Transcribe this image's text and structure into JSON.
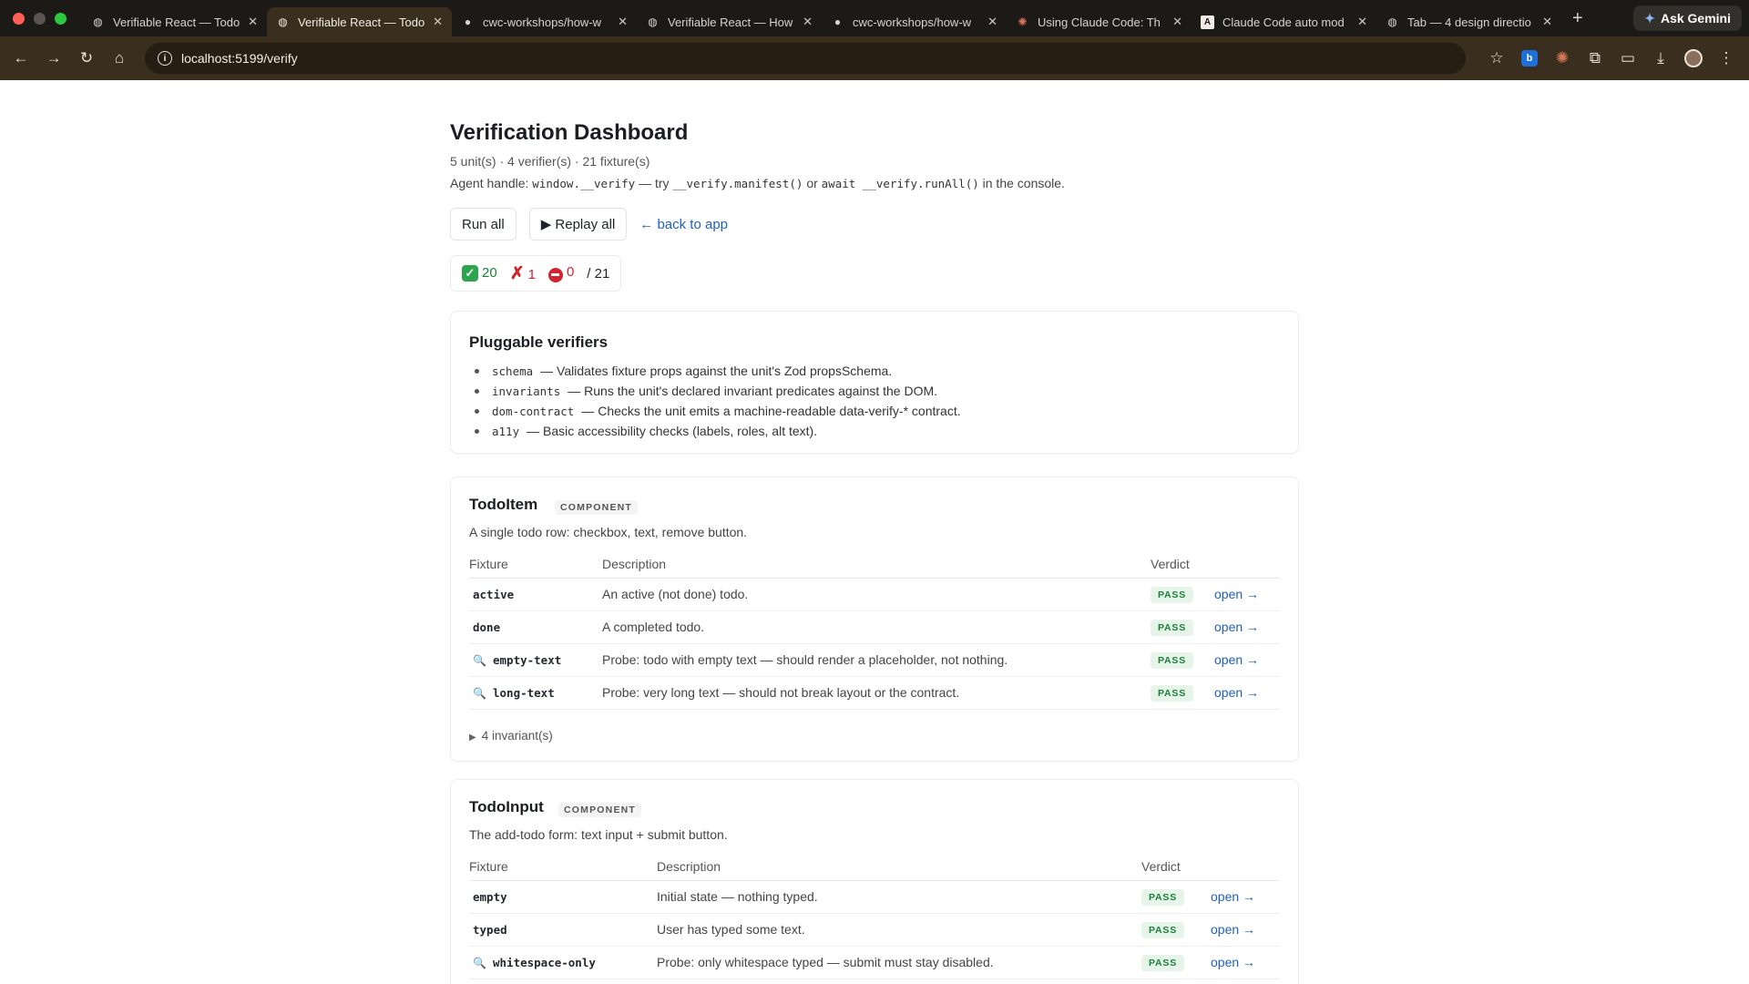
{
  "browser": {
    "tabs": [
      {
        "title": "Verifiable React — Todo",
        "icon": "globe-icon",
        "active": false
      },
      {
        "title": "Verifiable React — Todo",
        "icon": "globe-icon",
        "active": true
      },
      {
        "title": "cwc-workshops/how-w",
        "icon": "github-icon",
        "active": false
      },
      {
        "title": "Verifiable React — How",
        "icon": "globe-icon",
        "active": false
      },
      {
        "title": "cwc-workshops/how-w",
        "icon": "github-icon",
        "active": false
      },
      {
        "title": "Using Claude Code: Th",
        "icon": "claude-icon",
        "active": false
      },
      {
        "title": "Claude Code auto mod",
        "icon": "anthropic-icon",
        "active": false
      },
      {
        "title": "Tab — 4 design directio",
        "icon": "globe-icon",
        "active": false
      }
    ],
    "gemini_label": "Ask Gemini",
    "url": "localhost:5199/verify"
  },
  "page": {
    "title": "Verification Dashboard",
    "counts": "5 unit(s) · 4 verifier(s) · 21 fixture(s)",
    "handle": {
      "prefix": "Agent handle:",
      "code1": "window.__verify",
      "mid1": "— try",
      "code2": "__verify.manifest()",
      "mid2": "or",
      "code3": "await __verify.runAll()",
      "suffix": "in the console."
    },
    "buttons": {
      "run_all": "Run all",
      "replay_all": "▶ Replay all",
      "back": "← back to app"
    },
    "tally": {
      "pass": "20",
      "fail": "1",
      "error": "0",
      "total": "/ 21"
    }
  },
  "verifiers": {
    "heading": "Pluggable verifiers",
    "items": [
      {
        "name": "schema",
        "desc": "— Validates fixture props against the unit's Zod propsSchema."
      },
      {
        "name": "invariants",
        "desc": "— Runs the unit's declared invariant predicates against the DOM."
      },
      {
        "name": "dom-contract",
        "desc": "— Checks the unit emits a machine-readable data-verify-* contract."
      },
      {
        "name": "a11y",
        "desc": "— Basic accessibility checks (labels, roles, alt text)."
      }
    ]
  },
  "units": [
    {
      "name": "TodoItem",
      "kind": "COMPONENT",
      "description": "A single todo row: checkbox, text, remove button.",
      "columns": [
        "Fixture",
        "Description",
        "Verdict"
      ],
      "fixtures": [
        {
          "name": "active",
          "probe": false,
          "desc": "An active (not done) todo.",
          "verdict": "PASS",
          "link": "open →"
        },
        {
          "name": "done",
          "probe": false,
          "desc": "A completed todo.",
          "verdict": "PASS",
          "link": "open →"
        },
        {
          "name": "empty-text",
          "probe": true,
          "desc": "Probe: todo with empty text — should render a placeholder, not nothing.",
          "verdict": "PASS",
          "link": "open →"
        },
        {
          "name": "long-text",
          "probe": true,
          "desc": "Probe: very long text — should not break layout or the contract.",
          "verdict": "PASS",
          "link": "open →"
        }
      ],
      "invariants": "4 invariant(s)"
    },
    {
      "name": "TodoInput",
      "kind": "COMPONENT",
      "description": "The add-todo form: text input + submit button.",
      "columns": [
        "Fixture",
        "Description",
        "Verdict"
      ],
      "fixtures": [
        {
          "name": "empty",
          "probe": false,
          "desc": "Initial state — nothing typed.",
          "verdict": "PASS",
          "link": "open →"
        },
        {
          "name": "typed",
          "probe": false,
          "desc": "User has typed some text.",
          "verdict": "PASS",
          "link": "open →"
        },
        {
          "name": "whitespace-only",
          "probe": true,
          "desc": "Probe: only whitespace typed — submit must stay disabled.",
          "verdict": "PASS",
          "link": "open →"
        }
      ]
    }
  ]
}
